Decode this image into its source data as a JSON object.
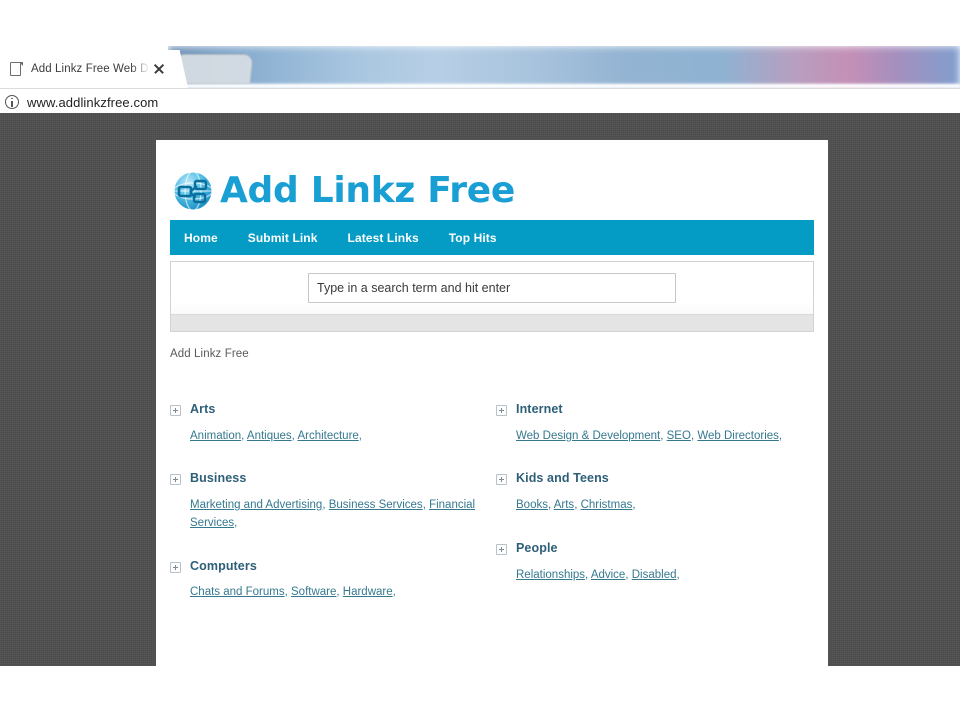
{
  "browser": {
    "tab": {
      "title": "Add Linkz Free Web Dire",
      "favicon": "page-icon",
      "close": "close-icon"
    },
    "urlbar": {
      "info_icon": "info-icon",
      "url": "www.addlinkzfree.com"
    }
  },
  "site": {
    "logo": {
      "text": "Add Linkz Free",
      "mark": "globe-link-icon",
      "color": "#1a9fd4"
    },
    "nav": {
      "bg_color": "#049cc5",
      "items": [
        {
          "label": "Home"
        },
        {
          "label": "Submit Link"
        },
        {
          "label": "Latest Links"
        },
        {
          "label": "Top Hits"
        }
      ]
    },
    "search": {
      "placeholder": "Type in a search term and hit enter",
      "value": ""
    },
    "breadcrumb": "Add Linkz Free",
    "categories_left": [
      {
        "name": "Arts",
        "expand_icon": "plus-box-icon",
        "links": [
          "Animation",
          "Antiques",
          "Architecture"
        ]
      },
      {
        "name": "Business",
        "expand_icon": "plus-box-icon",
        "links": [
          "Marketing and Advertising",
          "Business Services",
          "Financial Services"
        ]
      },
      {
        "name": "Computers",
        "expand_icon": "plus-box-icon",
        "links": [
          "Chats and Forums",
          "Software",
          "Hardware"
        ]
      }
    ],
    "categories_right": [
      {
        "name": "Internet",
        "expand_icon": "plus-box-icon",
        "links": [
          "Web Design & Development",
          "SEO",
          "Web Directories"
        ]
      },
      {
        "name": "Kids and Teens",
        "expand_icon": "plus-box-icon",
        "links": [
          "Books",
          "Arts",
          "Christmas"
        ]
      },
      {
        "name": "People",
        "expand_icon": "plus-box-icon",
        "links": [
          "Relationships",
          "Advice",
          "Disabled"
        ]
      }
    ],
    "link_color": "#35798f",
    "heading_color": "#2e5f79"
  },
  "desktop": {
    "background_color": "#4b4b4b"
  }
}
